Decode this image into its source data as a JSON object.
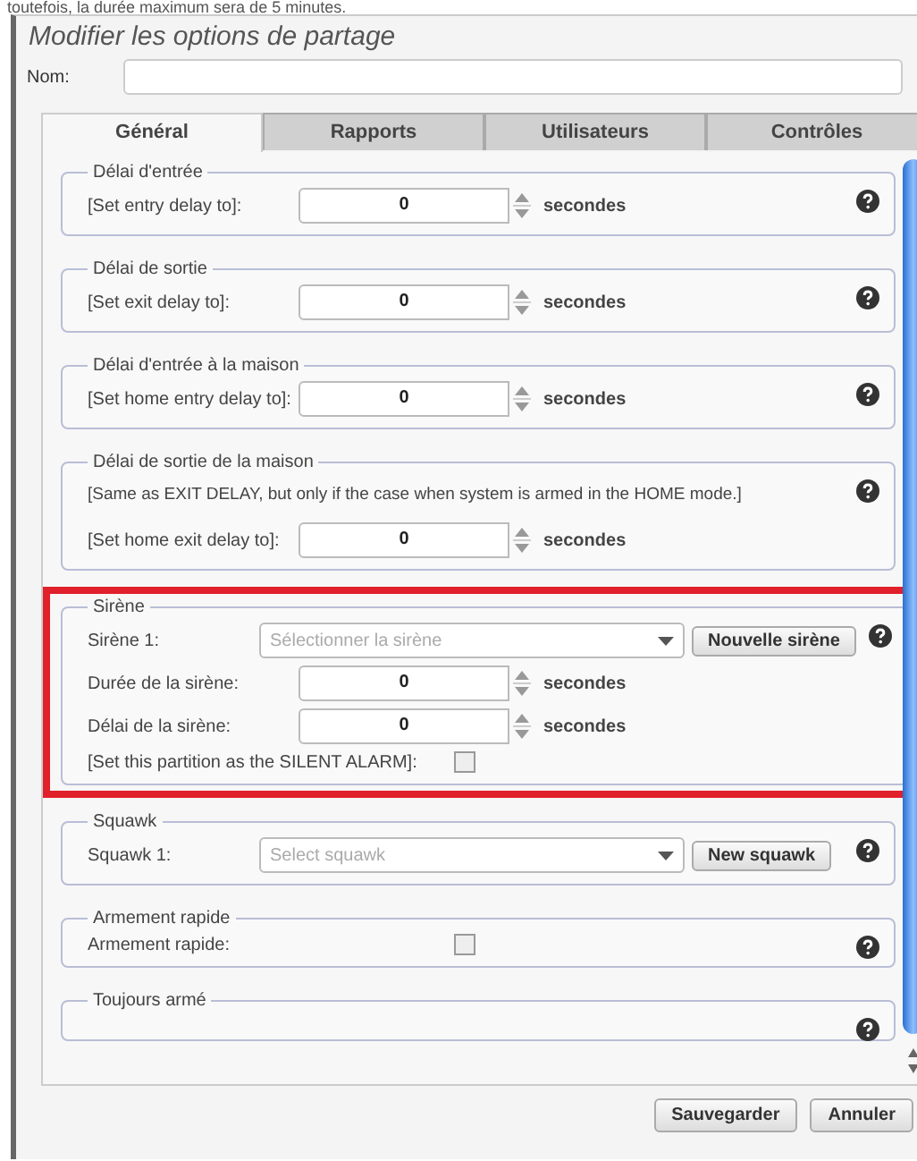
{
  "top_text": "toutefois, la durée maximum sera de 5 minutes.",
  "dialog": {
    "title": "Modifier les options de partage",
    "name_label": "Nom:"
  },
  "tabs": [
    {
      "label": "Général",
      "selected": true
    },
    {
      "label": "Rapports",
      "selected": false
    },
    {
      "label": "Utilisateurs",
      "selected": false
    },
    {
      "label": "Contrôles",
      "selected": false
    }
  ],
  "sections": [
    {
      "title": "Délai d'entrée",
      "highlighted": false,
      "rows": [
        {
          "kind": "spinner",
          "label": "[Set entry delay to]:",
          "value": "0",
          "unit": "secondes"
        }
      ]
    },
    {
      "title": "Délai de sortie",
      "highlighted": false,
      "rows": [
        {
          "kind": "spinner",
          "label": "[Set exit delay to]:",
          "value": "0",
          "unit": "secondes"
        }
      ]
    },
    {
      "title": "Délai d'entrée à la maison",
      "highlighted": false,
      "rows": [
        {
          "kind": "spinner",
          "label": "[Set home entry delay to]:",
          "value": "0",
          "unit": "secondes"
        }
      ]
    },
    {
      "title": "Délai de sortie de la maison",
      "highlighted": false,
      "rows": [
        {
          "kind": "note",
          "text": "[Same as EXIT DELAY, but only if the case when system is armed in the HOME mode.]"
        },
        {
          "kind": "spinner",
          "label": "[Set home exit delay to]:",
          "value": "0",
          "unit": "secondes"
        }
      ]
    },
    {
      "title": "Sirène",
      "highlighted": true,
      "rows": [
        {
          "kind": "select",
          "label": "Sirène 1:",
          "placeholder": "Sélectionner la sirène",
          "button": "Nouvelle sirène"
        },
        {
          "kind": "spinner",
          "label": "Durée de la sirène:",
          "value": "0",
          "unit": "secondes"
        },
        {
          "kind": "spinner",
          "label": "Délai de la sirène:",
          "value": "0",
          "unit": "secondes"
        },
        {
          "kind": "checkbox",
          "label": "[Set this partition as the SILENT ALARM]:",
          "checked": false
        }
      ]
    },
    {
      "title": "Squawk",
      "highlighted": false,
      "rows": [
        {
          "kind": "select",
          "label": "Squawk 1:",
          "placeholder": "Select squawk",
          "button": "New squawk"
        }
      ]
    },
    {
      "title": "Armement rapide",
      "highlighted": false,
      "rows": [
        {
          "kind": "checkbox",
          "label": "Armement rapide:",
          "checked": false
        }
      ]
    },
    {
      "title": "Toujours armé",
      "highlighted": false
    }
  ],
  "buttons": [
    {
      "label": "Sauvegarder"
    },
    {
      "label": "Annuler"
    }
  ]
}
